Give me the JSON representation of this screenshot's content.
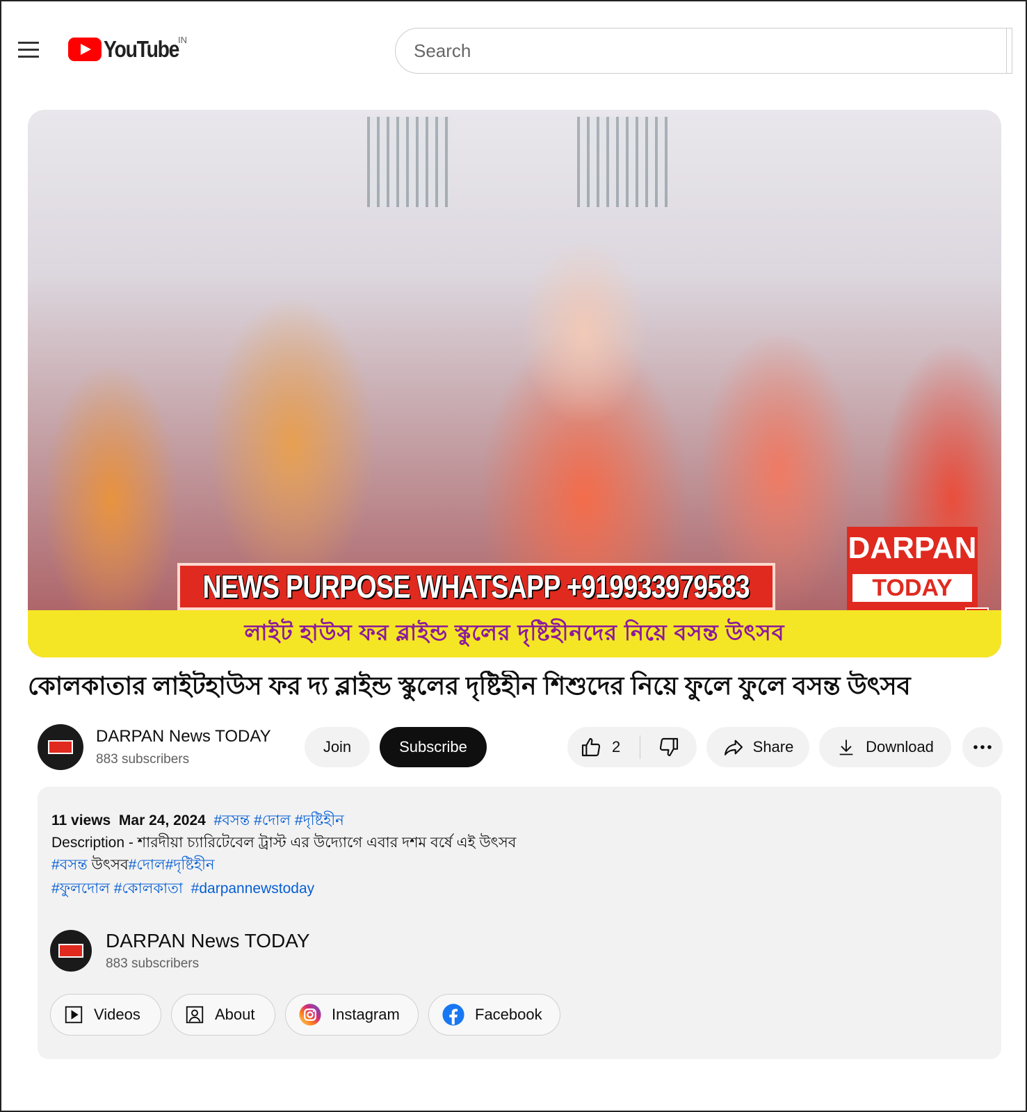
{
  "header": {
    "logo_text": "YouTube",
    "country_code": "IN",
    "search_placeholder": "Search"
  },
  "video": {
    "whatsapp_banner": "NEWS PURPOSE WHATSAPP +919933979583",
    "brand_top": "DARPAN",
    "brand_bottom": "TODAY",
    "ticker": "লাইট হাউস ফর ব্লাইন্ড স্কুলের দৃষ্টিহীনদের নিয়ে বসন্ত উৎসব"
  },
  "title": "কোলকাতার লাইটহাউস ফর দ্য ব্লাইন্ড স্কুলের দৃষ্টিহীন শিশুদের নিয়ে ফুলে ফুলে বসন্ত উৎসব",
  "channel": {
    "name": "DARPAN News TODAY",
    "subscribers": "883 subscribers",
    "join_label": "Join",
    "subscribe_label": "Subscribe"
  },
  "actions": {
    "like_count": "2",
    "share_label": "Share",
    "download_label": "Download"
  },
  "description": {
    "views": "11 views",
    "date": "Mar 24, 2024",
    "tags_top": [
      "#বসন্ত",
      "#দোল",
      "#দৃষ্টিহীন"
    ],
    "text": "Description - শারদীয়া চ্যারিটেবেল ট্রাস্ট এর উদ্যোগে এবার দশম বর্ষে এই উৎসব",
    "line3_tag1": "#বসন্ত",
    "line3_text": " উৎসব",
    "line3_tag2": "#দোল",
    "line3_tag3": "#দৃষ্টিহীন",
    "line4_tags": [
      "#ফুলদোল",
      "#কোলকাতা",
      "#darpannewstoday"
    ],
    "channel_name": "DARPAN News TODAY",
    "channel_subs": "883 subscribers",
    "chips": [
      "Videos",
      "About",
      "Instagram",
      "Facebook"
    ]
  },
  "colors": {
    "youtube_red": "#ff0000",
    "link_blue": "#065fd4",
    "darpan_red": "#e02a1f",
    "ticker_yellow": "#f5e625"
  }
}
